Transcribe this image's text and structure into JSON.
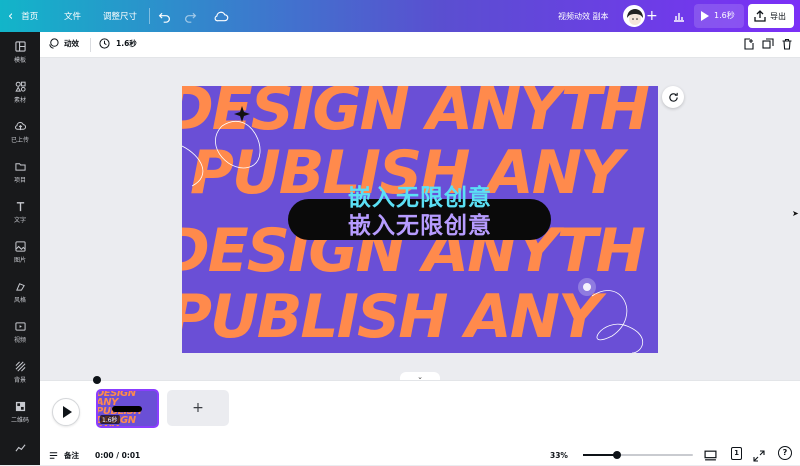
{
  "topbar": {
    "home_label": "首页",
    "file_label": "文件",
    "resize_label": "调整尺寸",
    "doc_title": "视频动效 副本",
    "play_duration": "1.6秒",
    "export_label": "导出"
  },
  "sidebar": {
    "items": [
      {
        "label": "模板",
        "icon": "template-icon"
      },
      {
        "label": "素材",
        "icon": "elements-icon"
      },
      {
        "label": "已上传",
        "icon": "upload-icon"
      },
      {
        "label": "项目",
        "icon": "folder-icon"
      },
      {
        "label": "文字",
        "icon": "text-icon"
      },
      {
        "label": "图片",
        "icon": "image-icon"
      },
      {
        "label": "风格",
        "icon": "style-icon"
      },
      {
        "label": "视频",
        "icon": "video-icon"
      },
      {
        "label": "背景",
        "icon": "background-icon"
      },
      {
        "label": "二维码",
        "icon": "qrcode-icon"
      },
      {
        "label": "",
        "icon": "chart-icon"
      }
    ]
  },
  "context_bar": {
    "animate_label": "动效",
    "duration_label": "1.6秒"
  },
  "artboard": {
    "bg_color": "#6a4fd6",
    "accent_color": "#ff8a4c",
    "lines": [
      "DESIGN ANYTH",
      "PUBLISH ANY",
      "DESIGN ANYTH",
      "PUBLISH ANY"
    ],
    "headline": "嵌入无限创意",
    "headline_shadow": "嵌入无限创意"
  },
  "timeline": {
    "thumb_duration": "1.6秒",
    "notes_label": "备注",
    "time_readout": "0:00 / 0:01",
    "zoom_percent": "33%",
    "zoom_level": 0.33,
    "page_number": "1"
  }
}
